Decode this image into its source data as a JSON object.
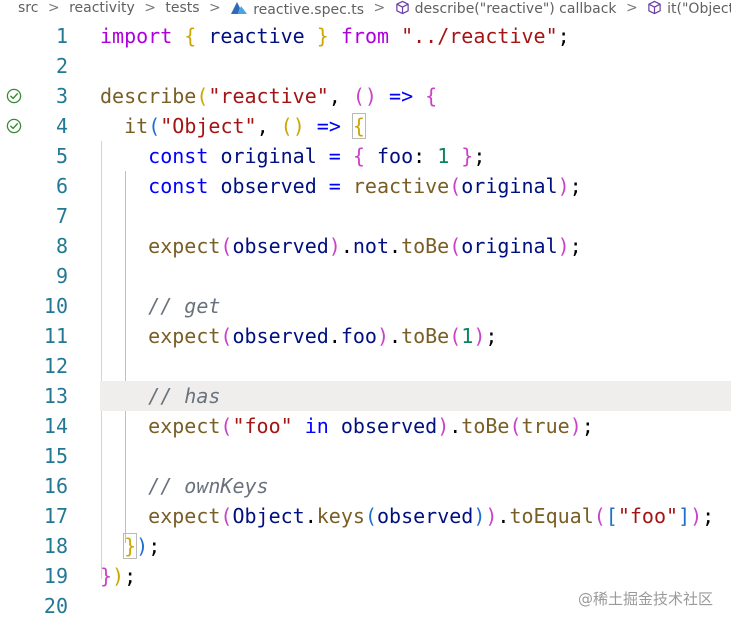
{
  "breadcrumb": {
    "items": [
      "src",
      "reactivity",
      "tests",
      "reactive.spec.ts",
      "describe(\"reactive\") callback",
      "it(\"Object\") callback"
    ],
    "separator": ">"
  },
  "editor": {
    "lines": [
      {
        "n": "1",
        "check": false,
        "highlight": false,
        "tokens": [
          {
            "t": "import",
            "c": "kw"
          },
          {
            "t": " "
          },
          {
            "t": "{",
            "c": "b1"
          },
          {
            "t": " reactive ",
            "c": "var"
          },
          {
            "t": "}",
            "c": "b1"
          },
          {
            "t": " "
          },
          {
            "t": "from",
            "c": "kw"
          },
          {
            "t": " "
          },
          {
            "t": "\"../reactive\"",
            "c": "str"
          },
          {
            "t": ";"
          }
        ]
      },
      {
        "n": "2",
        "check": false,
        "highlight": false,
        "tokens": []
      },
      {
        "n": "3",
        "check": true,
        "highlight": false,
        "tokens": [
          {
            "t": "describe",
            "c": "fn"
          },
          {
            "t": "(",
            "c": "b1"
          },
          {
            "t": "\"reactive\"",
            "c": "str"
          },
          {
            "t": ", "
          },
          {
            "t": "()",
            "c": "b2"
          },
          {
            "t": " => ",
            "c": "sb"
          },
          {
            "t": "{",
            "c": "b2"
          }
        ]
      },
      {
        "n": "4",
        "check": true,
        "highlight": false,
        "tokens": [
          {
            "t": "  "
          },
          {
            "t": "it",
            "c": "fn"
          },
          {
            "t": "(",
            "c": "b3"
          },
          {
            "t": "\"Object\"",
            "c": "str"
          },
          {
            "t": ", "
          },
          {
            "t": "()",
            "c": "b1"
          },
          {
            "t": " => ",
            "c": "sb"
          },
          {
            "t": "{",
            "c": "b1",
            "box": true
          }
        ]
      },
      {
        "n": "5",
        "check": false,
        "highlight": false,
        "tokens": [
          {
            "t": "    "
          },
          {
            "t": "const",
            "c": "sb"
          },
          {
            "t": " "
          },
          {
            "t": "original",
            "c": "var"
          },
          {
            "t": " = ",
            "c": "sb"
          },
          {
            "t": "{",
            "c": "b2"
          },
          {
            "t": " "
          },
          {
            "t": "foo",
            "c": "var"
          },
          {
            "t": ": "
          },
          {
            "t": "1",
            "c": "num"
          },
          {
            "t": " "
          },
          {
            "t": "}",
            "c": "b2"
          },
          {
            "t": ";"
          }
        ]
      },
      {
        "n": "6",
        "check": false,
        "highlight": false,
        "tokens": [
          {
            "t": "    "
          },
          {
            "t": "const",
            "c": "sb"
          },
          {
            "t": " "
          },
          {
            "t": "observed",
            "c": "var"
          },
          {
            "t": " = ",
            "c": "sb"
          },
          {
            "t": "reactive",
            "c": "fn"
          },
          {
            "t": "(",
            "c": "b2"
          },
          {
            "t": "original",
            "c": "var"
          },
          {
            "t": ")",
            "c": "b2"
          },
          {
            "t": ";"
          }
        ]
      },
      {
        "n": "7",
        "check": false,
        "highlight": false,
        "tokens": []
      },
      {
        "n": "8",
        "check": false,
        "highlight": false,
        "tokens": [
          {
            "t": "    "
          },
          {
            "t": "expect",
            "c": "fn"
          },
          {
            "t": "(",
            "c": "b2"
          },
          {
            "t": "observed",
            "c": "var"
          },
          {
            "t": ")",
            "c": "b2"
          },
          {
            "t": "."
          },
          {
            "t": "not",
            "c": "var"
          },
          {
            "t": "."
          },
          {
            "t": "toBe",
            "c": "fn"
          },
          {
            "t": "(",
            "c": "b2"
          },
          {
            "t": "original",
            "c": "var"
          },
          {
            "t": ")",
            "c": "b2"
          },
          {
            "t": ";"
          }
        ]
      },
      {
        "n": "9",
        "check": false,
        "highlight": false,
        "tokens": []
      },
      {
        "n": "10",
        "check": false,
        "highlight": false,
        "tokens": [
          {
            "t": "    "
          },
          {
            "t": "// get",
            "c": "cm"
          }
        ]
      },
      {
        "n": "11",
        "check": false,
        "highlight": false,
        "tokens": [
          {
            "t": "    "
          },
          {
            "t": "expect",
            "c": "fn"
          },
          {
            "t": "(",
            "c": "b2"
          },
          {
            "t": "observed",
            "c": "var"
          },
          {
            "t": "."
          },
          {
            "t": "foo",
            "c": "var"
          },
          {
            "t": ")",
            "c": "b2"
          },
          {
            "t": "."
          },
          {
            "t": "toBe",
            "c": "fn"
          },
          {
            "t": "(",
            "c": "b2"
          },
          {
            "t": "1",
            "c": "num"
          },
          {
            "t": ")",
            "c": "b2"
          },
          {
            "t": ";"
          }
        ]
      },
      {
        "n": "12",
        "check": false,
        "highlight": false,
        "tokens": []
      },
      {
        "n": "13",
        "check": false,
        "highlight": true,
        "tokens": [
          {
            "t": "    "
          },
          {
            "t": "// has",
            "c": "cm"
          }
        ]
      },
      {
        "n": "14",
        "check": false,
        "highlight": false,
        "tokens": [
          {
            "t": "    "
          },
          {
            "t": "expect",
            "c": "fn"
          },
          {
            "t": "(",
            "c": "b2"
          },
          {
            "t": "\"foo\"",
            "c": "str"
          },
          {
            "t": " "
          },
          {
            "t": "in",
            "c": "sb"
          },
          {
            "t": " "
          },
          {
            "t": "observed",
            "c": "var"
          },
          {
            "t": ")",
            "c": "b2"
          },
          {
            "t": "."
          },
          {
            "t": "toBe",
            "c": "fn"
          },
          {
            "t": "(",
            "c": "b2"
          },
          {
            "t": "true",
            "c": "fn"
          },
          {
            "t": ")",
            "c": "b2"
          },
          {
            "t": ";"
          }
        ]
      },
      {
        "n": "15",
        "check": false,
        "highlight": false,
        "tokens": []
      },
      {
        "n": "16",
        "check": false,
        "highlight": false,
        "tokens": [
          {
            "t": "    "
          },
          {
            "t": "// ownKeys",
            "c": "cm"
          }
        ]
      },
      {
        "n": "17",
        "check": false,
        "highlight": false,
        "tokens": [
          {
            "t": "    "
          },
          {
            "t": "expect",
            "c": "fn"
          },
          {
            "t": "(",
            "c": "b2"
          },
          {
            "t": "Object",
            "c": "var"
          },
          {
            "t": "."
          },
          {
            "t": "keys",
            "c": "fn"
          },
          {
            "t": "(",
            "c": "b3"
          },
          {
            "t": "observed",
            "c": "var"
          },
          {
            "t": ")",
            "c": "b3"
          },
          {
            "t": ")",
            "c": "b2"
          },
          {
            "t": "."
          },
          {
            "t": "toEqual",
            "c": "fn"
          },
          {
            "t": "(",
            "c": "b2"
          },
          {
            "t": "[",
            "c": "b3"
          },
          {
            "t": "\"foo\"",
            "c": "str"
          },
          {
            "t": "]",
            "c": "b3"
          },
          {
            "t": ")",
            "c": "b2"
          },
          {
            "t": ";"
          }
        ]
      },
      {
        "n": "18",
        "check": false,
        "highlight": false,
        "tokens": [
          {
            "t": "  "
          },
          {
            "t": "}",
            "c": "b1",
            "box": true
          },
          {
            "t": ")",
            "c": "b3"
          },
          {
            "t": ";"
          }
        ]
      },
      {
        "n": "19",
        "check": false,
        "highlight": false,
        "tokens": [
          {
            "t": "}",
            "c": "b2"
          },
          {
            "t": ")",
            "c": "b1"
          },
          {
            "t": ";"
          }
        ]
      },
      {
        "n": "20",
        "check": false,
        "highlight": false,
        "tokens": []
      }
    ]
  },
  "watermark": "@稀土掘金技术社区",
  "colors": {
    "line_number": "#237893",
    "check": "#388a34",
    "current_line": "#efeeec",
    "bracket_gold": "#cca700",
    "bracket_purple": "#c942c9",
    "bracket_blue": "#1f6fd1"
  },
  "icons": {
    "file": "typescript-test-file-icon",
    "symbol": "method-cube-icon",
    "test_status": "check-circle-icon"
  }
}
